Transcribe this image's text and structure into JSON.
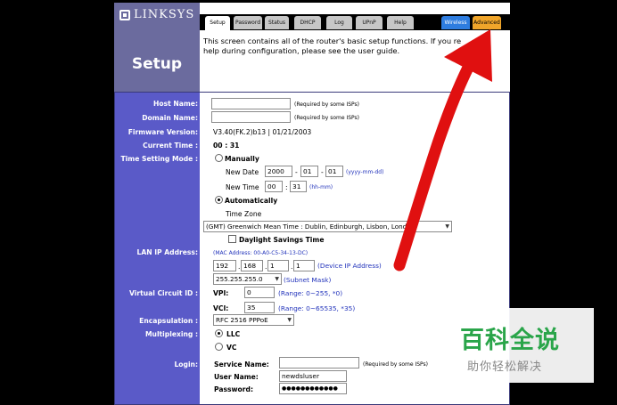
{
  "brand": "LINKSYS",
  "page_title": "Setup",
  "tabs": [
    {
      "label": "Setup"
    },
    {
      "label": "Password"
    },
    {
      "label": "Status"
    },
    {
      "label": "DHCP"
    },
    {
      "label": "Log"
    },
    {
      "label": "UPnP"
    },
    {
      "label": "Help"
    },
    {
      "label": "Wireless"
    },
    {
      "label": "Advanced"
    }
  ],
  "intro_text": "This screen contains all of the router's basic setup functions. If you re help during configuration, please see the user guide.",
  "labels": {
    "host_name": "Host Name:",
    "domain_name": "Domain Name:",
    "firmware_version": "Firmware Version:",
    "current_time": "Current Time :",
    "time_setting_mode": "Time Setting Mode :",
    "lan_ip": "LAN IP Address:",
    "virtual_circuit": "Virtual Circuit ID :",
    "encapsulation": "Encapsulation :",
    "multiplexing": "Multiplexing :",
    "login": "Login:"
  },
  "host_name": {
    "value": "",
    "note": "(Required by some ISPs)"
  },
  "domain_name": {
    "value": "",
    "note": "(Required by some ISPs)"
  },
  "firmware_version": "V3.40(FK.2)b13  |  01/21/2003",
  "current_time": "00 : 31",
  "time_mode": {
    "manual_label": "Manually",
    "new_date_label": "New Date",
    "date_year": "2000",
    "date_month": "01",
    "date_day": "01",
    "date_sep": "-",
    "date_hint": "(yyyy-mm-dd)",
    "new_time_label": "New Time",
    "time_hour": "00",
    "time_min": "31",
    "time_sep": ":",
    "time_hint": "(hh-mm)",
    "auto_label": "Automatically",
    "time_zone_label": "Time Zone",
    "time_zone_value": "(GMT) Greenwich Mean Time : Dublin, Edinburgh, Lisbon, London",
    "dst_label": "Daylight Savings Time"
  },
  "lan": {
    "mac": "(MAC Address: 00-A0-C5-34-13-DC)",
    "ip1": "192",
    "ip2": "168",
    "ip3": "1",
    "ip4": "1",
    "dot": ".",
    "ip_hint": "(Device IP Address)",
    "mask": "255.255.255.0",
    "mask_hint": "(Subnet Mask)"
  },
  "vc": {
    "vpi_label": "VPI:",
    "vpi_value": "0",
    "vpi_hint": "(Range: 0~255, *0)",
    "vci_label": "VCI:",
    "vci_value": "35",
    "vci_hint": "(Range: 0~65535, *35)"
  },
  "encapsulation": "RFC 2516 PPPoE",
  "multiplexing": {
    "llc": "LLC",
    "vc": "VC"
  },
  "login": {
    "service_label": "Service Name:",
    "service_value": "",
    "service_note": "(Required by some ISPs)",
    "user_label": "User Name:",
    "user_value": "newdsluser",
    "pass_label": "Password:",
    "pass_value": "●●●●●●●●●●●●"
  },
  "watermark": {
    "main": "百科全说",
    "sub": "助你轻松解决"
  },
  "colors": {
    "left_panel": "#5a5ac8",
    "header": "#6b6b9e",
    "arrow": "#e01010",
    "hint_blue": "#2233bb",
    "watermark_green": "#2aa54a"
  }
}
